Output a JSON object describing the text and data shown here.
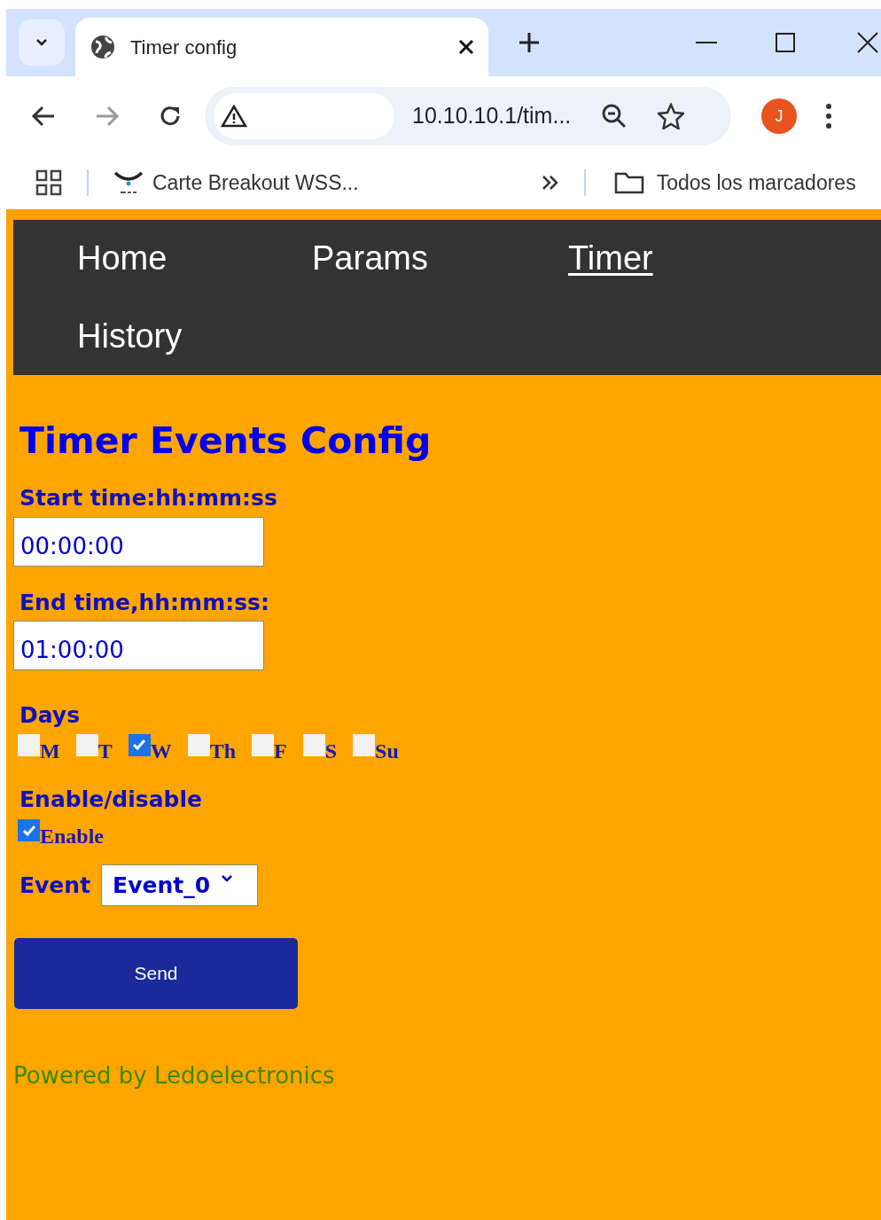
{
  "browser": {
    "tab_title": "Timer config",
    "address": "10.10.10.1/tim...",
    "profile_initial": "J",
    "bookmarks": [
      {
        "label": "Carte Breakout WSS..."
      }
    ],
    "all_bookmarks": "Todos los marcadores"
  },
  "nav": [
    {
      "label": "Home",
      "selected": false
    },
    {
      "label": "Params",
      "selected": false
    },
    {
      "label": "Timer",
      "selected": true
    },
    {
      "label": "History",
      "selected": false
    }
  ],
  "heading": "Timer Events Config",
  "fields": [
    {
      "label": "Start time:hh:mm:ss",
      "value": "00:00:00"
    },
    {
      "label": "End time,hh:mm:ss:",
      "value": "01:00:00"
    }
  ],
  "days": {
    "label": "Days",
    "items": [
      {
        "label": "M",
        "checked": false
      },
      {
        "label": "T",
        "checked": false
      },
      {
        "label": "W",
        "checked": true
      },
      {
        "label": "Th",
        "checked": false
      },
      {
        "label": "F",
        "checked": false
      },
      {
        "label": "S",
        "checked": false
      },
      {
        "label": "Su",
        "checked": false
      }
    ]
  },
  "enable": {
    "label": "Enable/disable",
    "option": "Enable",
    "checked": true
  },
  "event": {
    "label": "Event",
    "value": "Event_0"
  },
  "send_button": "Send",
  "footer": "Powered by Ledoelectronics"
}
